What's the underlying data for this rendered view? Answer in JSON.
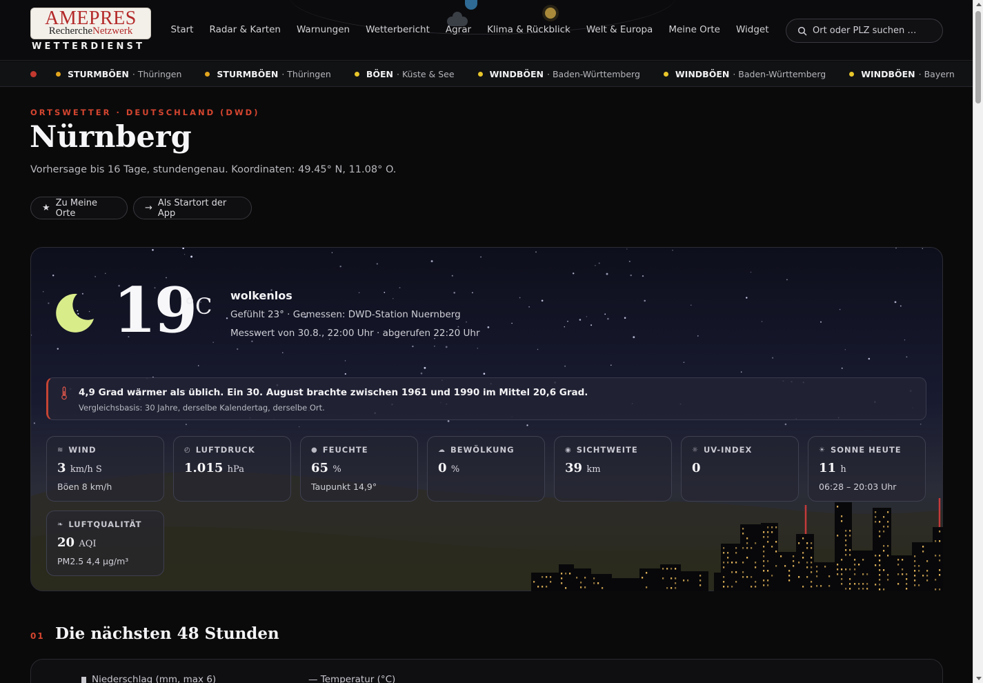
{
  "logo": {
    "line1": "AMEPRES",
    "line2_a": "Recherche",
    "line2_b": "Netzwerk",
    "sub": "WETTERDIENST"
  },
  "nav": [
    "Start",
    "Radar & Karten",
    "Warnungen",
    "Wetterbericht",
    "Agrar",
    "Klima & Rückblick",
    "Welt & Europa",
    "Meine Orte",
    "Widget"
  ],
  "search": {
    "placeholder": "Ort oder PLZ suchen …"
  },
  "ticker": [
    {
      "type": "STURMBÖEN",
      "region": "Thüringen",
      "color": "#e2a51d"
    },
    {
      "type": "STURMBÖEN",
      "region": "Thüringen",
      "color": "#e2a51d"
    },
    {
      "type": "BÖEN",
      "region": "Küste & See",
      "color": "#e9c62a"
    },
    {
      "type": "WINDBÖEN",
      "region": "Baden-Württemberg",
      "color": "#e9c62a"
    },
    {
      "type": "WINDBÖEN",
      "region": "Baden-Württemberg",
      "color": "#e9c62a"
    },
    {
      "type": "WINDBÖEN",
      "region": "Bayern",
      "color": "#e9c62a"
    }
  ],
  "location": {
    "eyebrow": "ORTSWETTER · DEUTSCHLAND (DWD)",
    "city": "Nürnberg",
    "subline": "Vorhersage bis 16 Tage, stundengenau. Koordinaten: 49.45° N, 11.08° O.",
    "btn_fav": "Zu Meine Orte",
    "btn_start": "Als Startort der App"
  },
  "current": {
    "temp": "19",
    "unit": "°C",
    "condition": "wolkenlos",
    "meta1": "Gefühlt 23° · Gemessen: DWD-Station Nuernberg",
    "meta2": "Messwert von 30.8., 22:00 Uhr · abgerufen 22:20 Uhr",
    "icon": "moon-icon"
  },
  "anomaly": {
    "bold": "4,9 Grad wärmer als üblich.",
    "text": " Ein 30. August brachte zwischen 1961 und 1990 im Mittel 20,6 Grad.",
    "basis": "Vergleichsbasis: 30 Jahre, derselbe Kalendertag, derselbe Ort."
  },
  "tiles": [
    {
      "label": "WIND",
      "icon": "wind-icon",
      "glyph": "≋",
      "value": "3",
      "unit": "km/h S",
      "sub": "Böen 8 km/h"
    },
    {
      "label": "LUFTDRUCK",
      "icon": "gauge-icon",
      "glyph": "◴",
      "value": "1.015",
      "unit": "hPa",
      "sub": ""
    },
    {
      "label": "FEUCHTE",
      "icon": "droplet-icon",
      "glyph": "●",
      "value": "65",
      "unit": "%",
      "sub": "Taupunkt 14,9°"
    },
    {
      "label": "BEWÖLKUNG",
      "icon": "cloud-icon",
      "glyph": "☁",
      "value": "0",
      "unit": "%",
      "sub": ""
    },
    {
      "label": "SICHTWEITE",
      "icon": "eye-icon",
      "glyph": "◉",
      "value": "39",
      "unit": "km",
      "sub": ""
    },
    {
      "label": "UV-INDEX",
      "icon": "sun-icon",
      "glyph": "☼",
      "value": "0",
      "unit": "",
      "sub": ""
    },
    {
      "label": "SONNE HEUTE",
      "icon": "sunrise-icon",
      "glyph": "☀",
      "value": "11",
      "unit": "h",
      "sub": "06:28 – 20:03 Uhr"
    },
    {
      "label": "LUFTQUALITÄT",
      "icon": "leaf-icon",
      "glyph": "❧",
      "value": "20",
      "unit": "AQI",
      "sub": "PM2.5 4,4 µg/m³"
    }
  ],
  "section": {
    "num": "01",
    "title": "Die nächsten 48 Stunden",
    "legend_precip": "Niederschlag (mm, max 6)",
    "legend_temp": "— Temperatur (°C)"
  }
}
